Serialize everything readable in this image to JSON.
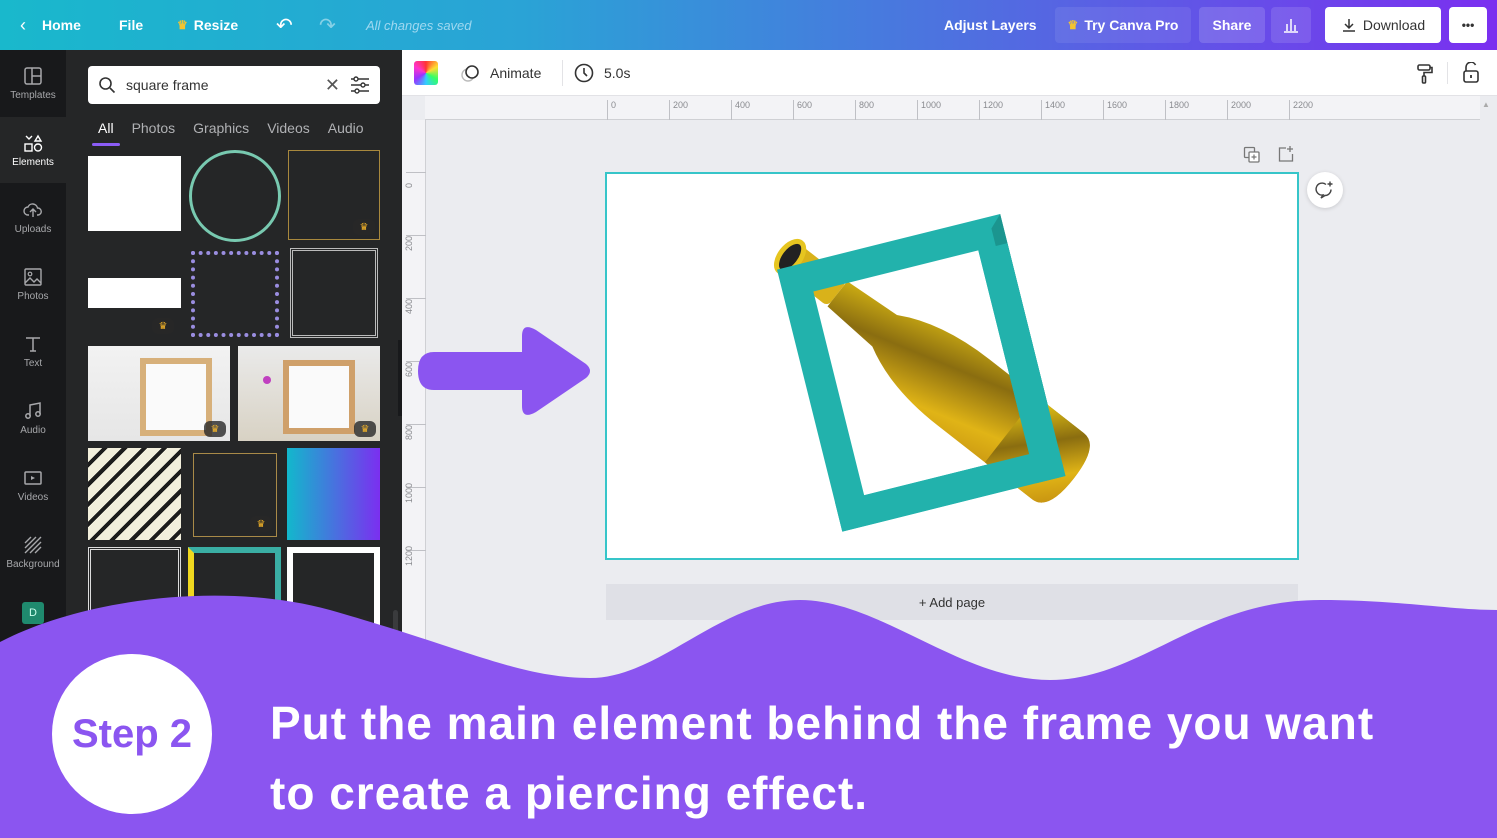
{
  "topbar": {
    "home": "Home",
    "file": "File",
    "resize": "Resize",
    "saved_status": "All changes saved",
    "adjust_layers": "Adjust Layers",
    "try_pro": "Try Canva Pro",
    "share": "Share",
    "download": "Download",
    "more": "•••"
  },
  "leftnav": [
    {
      "label": "Templates",
      "icon": "templates-icon"
    },
    {
      "label": "Elements",
      "icon": "elements-icon",
      "active": true
    },
    {
      "label": "Uploads",
      "icon": "upload-cloud-icon"
    },
    {
      "label": "Photos",
      "icon": "photos-icon"
    },
    {
      "label": "Text",
      "icon": "text-icon"
    },
    {
      "label": "Audio",
      "icon": "music-note-icon"
    },
    {
      "label": "Videos",
      "icon": "video-icon"
    },
    {
      "label": "Background",
      "icon": "background-pattern-icon"
    }
  ],
  "panel": {
    "search_value": "square frame",
    "tabs": [
      "All",
      "Photos",
      "Graphics",
      "Videos",
      "Audio"
    ],
    "active_tab": "All"
  },
  "toolbar": {
    "animate": "Animate",
    "duration": "5.0s"
  },
  "ruler": {
    "h_ticks": [
      "0",
      "200",
      "400",
      "600",
      "800",
      "1000",
      "1200",
      "1400",
      "1600",
      "1800",
      "2000",
      "2200"
    ],
    "v_ticks": [
      "0",
      "200",
      "400",
      "600",
      "800",
      "1000",
      "1200"
    ]
  },
  "canvas": {
    "add_page": "+ Add page"
  },
  "overlay": {
    "step": "Step 2",
    "caption_line1": "Put the main element behind the frame you want",
    "caption_line2": "to create a piercing effect.",
    "accent_color": "#8b55f0"
  }
}
